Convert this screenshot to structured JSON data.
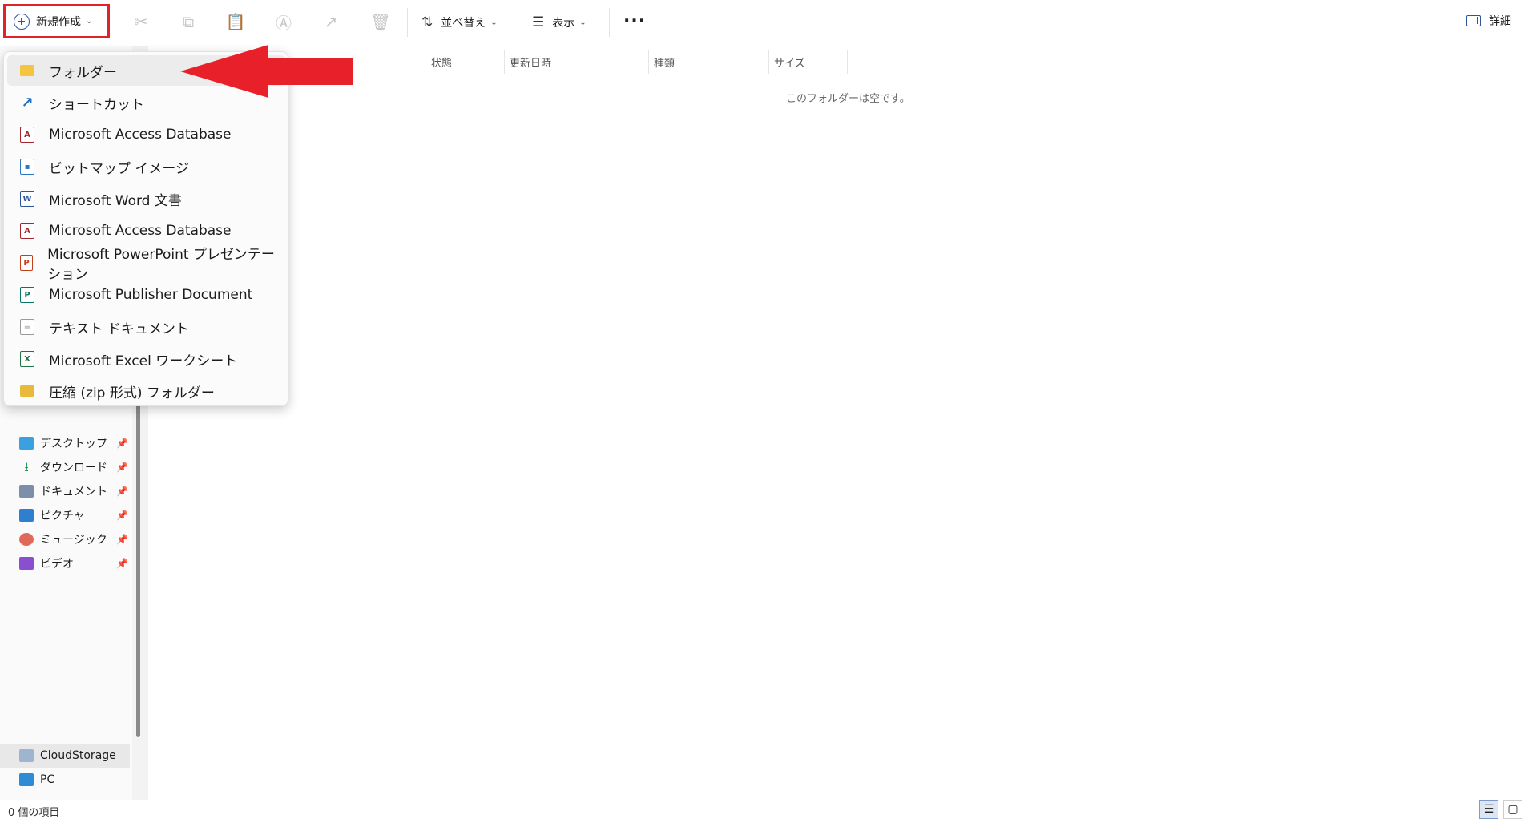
{
  "toolbar": {
    "new_label": "新規作成",
    "sort_label": "並べ替え",
    "view_label": "表示",
    "details_label": "詳細"
  },
  "columns": {
    "status": "状態",
    "modified": "更新日時",
    "type": "種類",
    "size": "サイズ"
  },
  "empty_message": "このフォルダーは空です。",
  "new_menu": {
    "items": [
      {
        "label": "フォルダー",
        "icon": "folder-icon"
      },
      {
        "label": "ショートカット",
        "icon": "shortcut-icon"
      },
      {
        "label": "Microsoft Access Database",
        "icon": "access-icon"
      },
      {
        "label": "ビットマップ イメージ",
        "icon": "bitmap-icon"
      },
      {
        "label": "Microsoft Word 文書",
        "icon": "word-icon"
      },
      {
        "label": "Microsoft Access Database",
        "icon": "access-icon"
      },
      {
        "label": "Microsoft PowerPoint プレゼンテーション",
        "icon": "powerpoint-icon"
      },
      {
        "label": "Microsoft Publisher Document",
        "icon": "publisher-icon"
      },
      {
        "label": "テキスト ドキュメント",
        "icon": "text-document-icon"
      },
      {
        "label": "Microsoft Excel ワークシート",
        "icon": "excel-icon"
      },
      {
        "label": "圧縮 (zip 形式) フォルダー",
        "icon": "zip-folder-icon"
      }
    ]
  },
  "nav": {
    "quick_access": [
      {
        "label": "デスクトップ",
        "icon": "desktop-icon"
      },
      {
        "label": "ダウンロード",
        "icon": "download-icon"
      },
      {
        "label": "ドキュメント",
        "icon": "documents-icon"
      },
      {
        "label": "ピクチャ",
        "icon": "pictures-icon"
      },
      {
        "label": "ミュージック",
        "icon": "music-icon"
      },
      {
        "label": "ビデオ",
        "icon": "videos-icon"
      }
    ],
    "cloud": "CloudStorage",
    "pc": "PC"
  },
  "status": {
    "item_count": "0 個の項目"
  },
  "colors": {
    "highlight_box": "#e0222a",
    "arrow": "#e8202a",
    "accent": "#2b5797"
  }
}
